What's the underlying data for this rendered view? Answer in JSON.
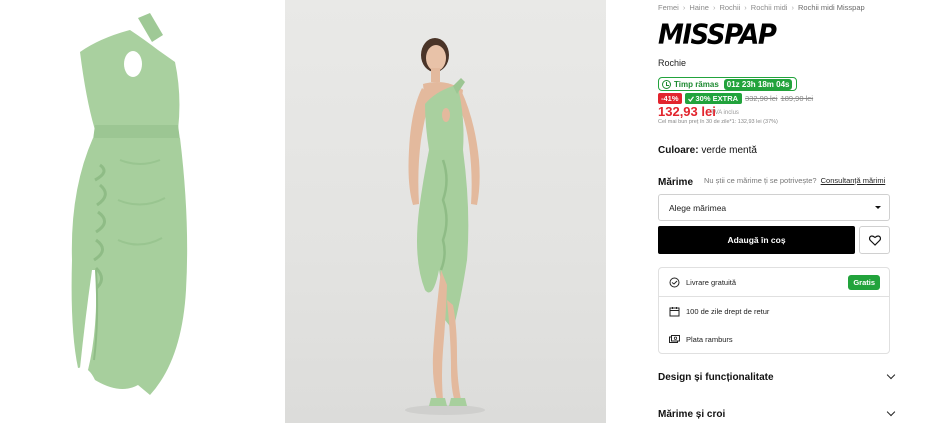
{
  "breadcrumb": [
    "Femei",
    "Haine",
    "Rochii",
    "Rochii midi",
    "Rochii midi Misspap"
  ],
  "breadcrumb_sep": "›",
  "product": {
    "brand": "MISSPAP",
    "name": "Rochie",
    "timer_label": "Timp rămas",
    "timer_value": "01z 23h 18m 04s",
    "discount_badge": "-41%",
    "extra_badge": "30% EXTRA",
    "old_price_1": "332,90 lei",
    "old_price_2": "189,90 lei",
    "price": "132,93 lei",
    "vat_note": "TVA inclus",
    "lowest_price_note": "Cel mai bun preț în 30 de zile*1: 132,93 lei (37%)"
  },
  "color": {
    "label": "Culoare:",
    "value": "verde mentă"
  },
  "size": {
    "label": "Mărime",
    "help_text": "Nu știi ce mărime ți se potrivește?",
    "help_link": "Consultanță mărimi",
    "select_placeholder": "Alege mărimea"
  },
  "actions": {
    "add_to_cart": "Adaugă în coș"
  },
  "benefits": [
    {
      "icon": "delivery-icon",
      "text": "Livrare gratuită",
      "badge": "Gratis"
    },
    {
      "icon": "calendar-icon",
      "text": "100 de zile drept de retur"
    },
    {
      "icon": "cash-icon",
      "text": "Plata ramburs"
    }
  ],
  "accordions": [
    {
      "label": "Design și funcționalitate"
    },
    {
      "label": "Mărime și croi"
    }
  ],
  "colors": {
    "dress": "#a7cf9d",
    "dress_shade": "#8fbc86",
    "sale_red": "#e2242d",
    "green": "#22a33c"
  }
}
